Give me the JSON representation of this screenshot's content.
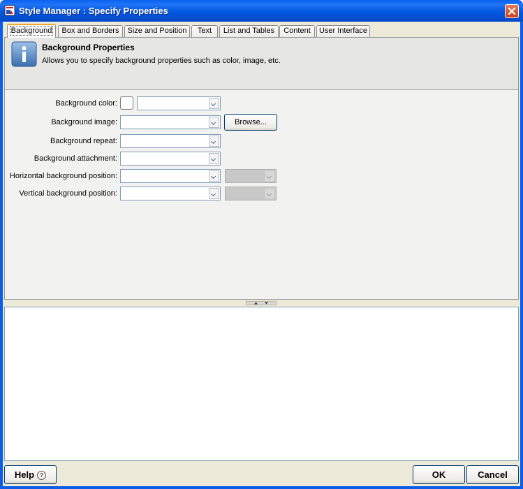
{
  "window": {
    "title": "Style Manager : Specify Properties"
  },
  "tabs": [
    {
      "label": "Background",
      "active": true
    },
    {
      "label": "Box and Borders"
    },
    {
      "label": "Size and Position"
    },
    {
      "label": "Text"
    },
    {
      "label": "List and Tables"
    },
    {
      "label": "Content"
    },
    {
      "label": "User Interface"
    }
  ],
  "info": {
    "title": "Background Properties",
    "description": "Allows you to specify background properties such as color, image, etc.",
    "icon": "info-icon"
  },
  "form": {
    "color_label": "Background color:",
    "image_label": "Background image:",
    "repeat_label": "Background repeat:",
    "attachment_label": "Background attachment:",
    "hpos_label": "Horizontal background position:",
    "vpos_label": "Vertical background position:",
    "browse_label": "Browse..."
  },
  "footer": {
    "help_label": "Help",
    "ok_label": "OK",
    "cancel_label": "Cancel"
  },
  "colors": {
    "titlebar": "#0a5ee8",
    "dialog_bg": "#ece9d8",
    "active_tab_accent": "#f2a42e"
  }
}
